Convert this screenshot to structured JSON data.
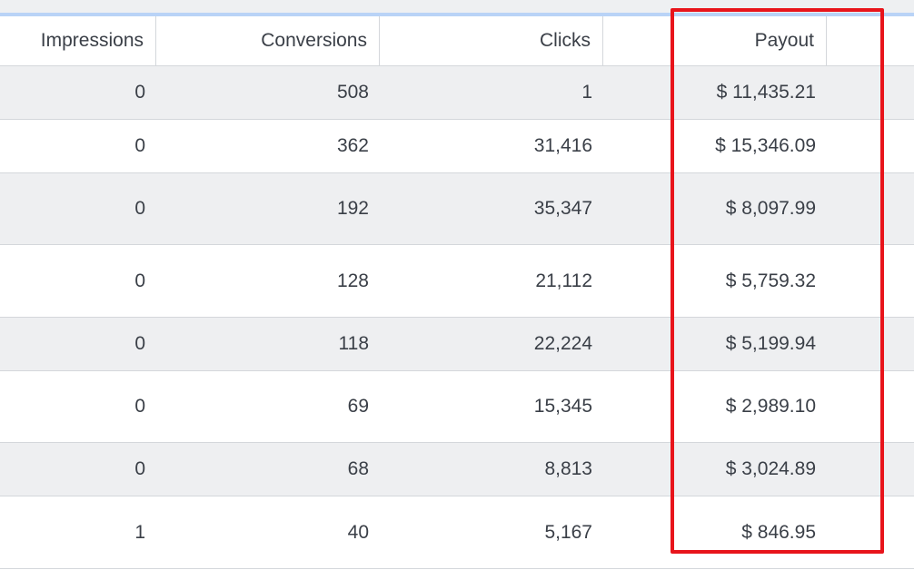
{
  "table": {
    "headers": {
      "impressions": "Impressions",
      "conversions": "Conversions",
      "clicks": "Clicks",
      "payout": "Payout"
    },
    "rows": [
      {
        "impressions": "0",
        "conversions": "508",
        "clicks": "1",
        "payout": "$ 11,435.21"
      },
      {
        "impressions": "0",
        "conversions": "362",
        "clicks": "31,416",
        "payout": "$ 15,346.09"
      },
      {
        "impressions": "0",
        "conversions": "192",
        "clicks": "35,347",
        "payout": "$ 8,097.99"
      },
      {
        "impressions": "0",
        "conversions": "128",
        "clicks": "21,112",
        "payout": "$ 5,759.32"
      },
      {
        "impressions": "0",
        "conversions": "118",
        "clicks": "22,224",
        "payout": "$ 5,199.94"
      },
      {
        "impressions": "0",
        "conversions": "69",
        "clicks": "15,345",
        "payout": "$ 2,989.10"
      },
      {
        "impressions": "0",
        "conversions": "68",
        "clicks": "8,813",
        "payout": "$ 3,024.89"
      },
      {
        "impressions": "1",
        "conversions": "40",
        "clicks": "5,167",
        "payout": "$ 846.95"
      }
    ]
  },
  "colors": {
    "highlight": "#e8141b",
    "header_accent": "#b9d3f7",
    "stripe": "#eeeff1"
  }
}
